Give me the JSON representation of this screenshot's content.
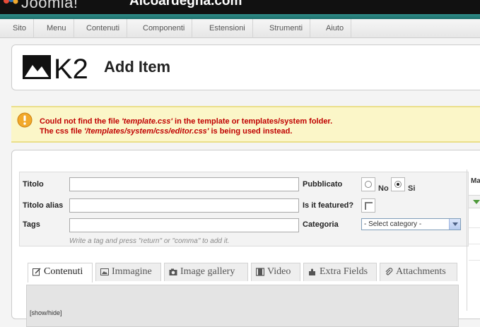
{
  "header": {
    "brand": "Joomla!",
    "site_name": "Alcoardegna.com"
  },
  "menu": {
    "items": [
      "Sito",
      "Menu",
      "Contenuti",
      "Componenti",
      "Estensioni",
      "Strumenti",
      "Aiuto"
    ]
  },
  "toolbar": {
    "logo_text": "K2",
    "title": "Add Item"
  },
  "warning": {
    "line1_prefix": "Could not find the file ",
    "line1_file": "'template.css'",
    "line1_suffix": " in the template or templates/system folder.",
    "line2_prefix": "The css file ",
    "line2_file": "'/templates/system/css/editor.css'",
    "line2_suffix": " is being used instead."
  },
  "form": {
    "title_label": "Titolo",
    "title_value": "",
    "alias_label": "Titolo alias",
    "alias_value": "",
    "tags_label": "Tags",
    "tags_value": "",
    "tags_hint": "Write a tag and press \"return\" or \"comma\" to add it.",
    "published_label": "Pubblicato",
    "published_no": "No",
    "published_yes": "Si",
    "published_selected": "Si",
    "featured_label": "Is it featured?",
    "featured_checked": false,
    "category_label": "Categoria",
    "category_selected": "- Select category -"
  },
  "tabs": [
    {
      "label": "Contenuti",
      "icon": "edit-icon",
      "active": true
    },
    {
      "label": "Immagine",
      "icon": "image-icon",
      "active": false
    },
    {
      "label": "Image gallery",
      "icon": "camera-icon",
      "active": false
    },
    {
      "label": "Video",
      "icon": "film-icon",
      "active": false
    },
    {
      "label": "Extra Fields",
      "icon": "puzzle-icon",
      "active": false
    },
    {
      "label": "Attachments",
      "icon": "paperclip-icon",
      "active": false
    }
  ],
  "editor": {
    "toggle_label": "[show/hide]"
  },
  "side": {
    "label": "Ma"
  },
  "colors": {
    "teal": "#2f8e8a",
    "warning_text": "#c00000",
    "warning_bg": "#fbf6c8"
  }
}
